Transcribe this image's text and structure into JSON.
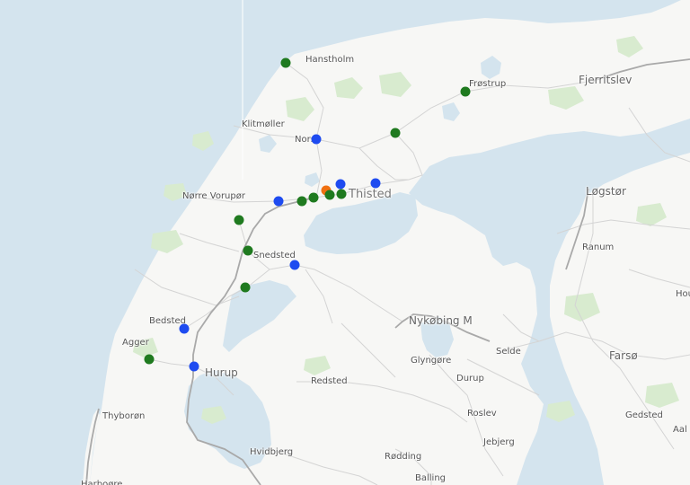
{
  "colors": {
    "water": "#d4e4ee",
    "land": "#f7f7f5",
    "green": "#d8ebcf",
    "road": "#d4d4d4",
    "highway": "#a9a9a9",
    "marker_green": "#1f7a1f",
    "marker_blue": "#1e4bf0",
    "marker_orange": "#f07010"
  },
  "places": [
    {
      "name": "Hanstholm",
      "type": "place"
    },
    {
      "name": "Frøstrup",
      "type": "place"
    },
    {
      "name": "Fjerritslev",
      "type": "town"
    },
    {
      "name": "Klitmøller",
      "type": "place"
    },
    {
      "name": "Nors",
      "type": "place"
    },
    {
      "name": "Thisted",
      "type": "city"
    },
    {
      "name": "Nørre Vorupør",
      "type": "place"
    },
    {
      "name": "Løgstør",
      "type": "town"
    },
    {
      "name": "Ranum",
      "type": "place"
    },
    {
      "name": "Snedsted",
      "type": "place"
    },
    {
      "name": "Hou",
      "type": "place"
    },
    {
      "name": "Bedsted",
      "type": "place"
    },
    {
      "name": "Agger",
      "type": "place"
    },
    {
      "name": "Nykøbing M",
      "type": "town"
    },
    {
      "name": "Selde",
      "type": "place"
    },
    {
      "name": "Glyngøre",
      "type": "place"
    },
    {
      "name": "Farsø",
      "type": "town"
    },
    {
      "name": "Hurup",
      "type": "town"
    },
    {
      "name": "Redsted",
      "type": "place"
    },
    {
      "name": "Durup",
      "type": "place"
    },
    {
      "name": "Thyborøn",
      "type": "place"
    },
    {
      "name": "Roslev",
      "type": "place"
    },
    {
      "name": "Gedsted",
      "type": "place"
    },
    {
      "name": "Aal",
      "type": "place"
    },
    {
      "name": "Jebjerg",
      "type": "place"
    },
    {
      "name": "Hvidbjerg",
      "type": "place"
    },
    {
      "name": "Rødding",
      "type": "place"
    },
    {
      "name": "Balling",
      "type": "place"
    },
    {
      "name": "Harboøre",
      "type": "place"
    }
  ],
  "markers": [
    {
      "color": "marker_green"
    },
    {
      "color": "marker_green"
    },
    {
      "color": "marker_blue"
    },
    {
      "color": "marker_green"
    },
    {
      "color": "marker_blue"
    },
    {
      "color": "marker_orange"
    },
    {
      "color": "marker_blue"
    },
    {
      "color": "marker_green"
    },
    {
      "color": "marker_green"
    },
    {
      "color": "marker_green"
    },
    {
      "color": "marker_green"
    },
    {
      "color": "marker_blue"
    },
    {
      "color": "marker_green"
    },
    {
      "color": "marker_green"
    },
    {
      "color": "marker_blue"
    },
    {
      "color": "marker_green"
    },
    {
      "color": "marker_green"
    },
    {
      "color": "marker_blue"
    },
    {
      "color": "marker_blue"
    }
  ]
}
